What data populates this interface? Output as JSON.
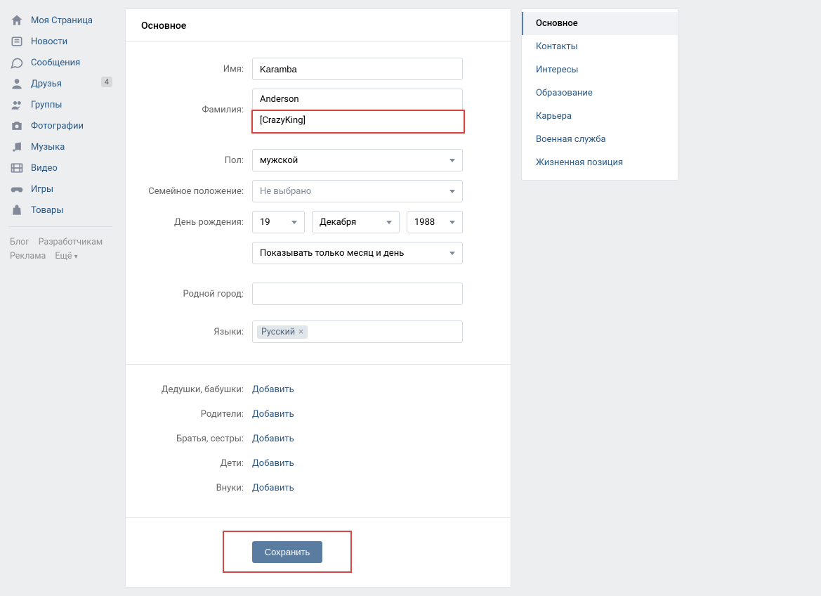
{
  "left_nav": {
    "items": [
      {
        "label": "Моя Страница",
        "icon": "home"
      },
      {
        "label": "Новости",
        "icon": "newspaper"
      },
      {
        "label": "Сообщения",
        "icon": "message"
      },
      {
        "label": "Друзья",
        "icon": "user",
        "badge": "4"
      },
      {
        "label": "Группы",
        "icon": "users"
      },
      {
        "label": "Фотографии",
        "icon": "camera"
      },
      {
        "label": "Музыка",
        "icon": "music"
      },
      {
        "label": "Видео",
        "icon": "film"
      },
      {
        "label": "Игры",
        "icon": "gamepad"
      },
      {
        "label": "Товары",
        "icon": "bag"
      }
    ],
    "footer": {
      "blog": "Блог",
      "developers": "Разработчикам",
      "ads": "Реклама",
      "more": "Ещё"
    }
  },
  "main": {
    "title": "Основное",
    "labels": {
      "first_name": "Имя:",
      "last_name": "Фамилия:",
      "maiden": "",
      "gender": "Пол:",
      "marital": "Семейное положение:",
      "birthday": "День рождения:",
      "hometown": "Родной город:",
      "languages": "Языки:",
      "grandparents": "Дедушки, бабушки:",
      "parents": "Родители:",
      "siblings": "Братья, сестры:",
      "children": "Дети:",
      "grandchildren": "Внуки:"
    },
    "values": {
      "first_name": "Karamba",
      "last_name": "Anderson",
      "maiden": "[CrazyKing]",
      "gender": "мужской",
      "marital": "Не выбрано",
      "bday_day": "19",
      "bday_month": "Декабря",
      "bday_year": "1988",
      "bday_visibility": "Показывать только месяц и день",
      "hometown": "",
      "language_token": "Русский"
    },
    "add_link": "Добавить",
    "save_button": "Сохранить"
  },
  "right_nav": {
    "items": [
      {
        "label": "Основное",
        "active": true
      },
      {
        "label": "Контакты"
      },
      {
        "label": "Интересы"
      },
      {
        "label": "Образование"
      },
      {
        "label": "Карьера"
      },
      {
        "label": "Военная служба"
      },
      {
        "label": "Жизненная позиция"
      }
    ]
  }
}
